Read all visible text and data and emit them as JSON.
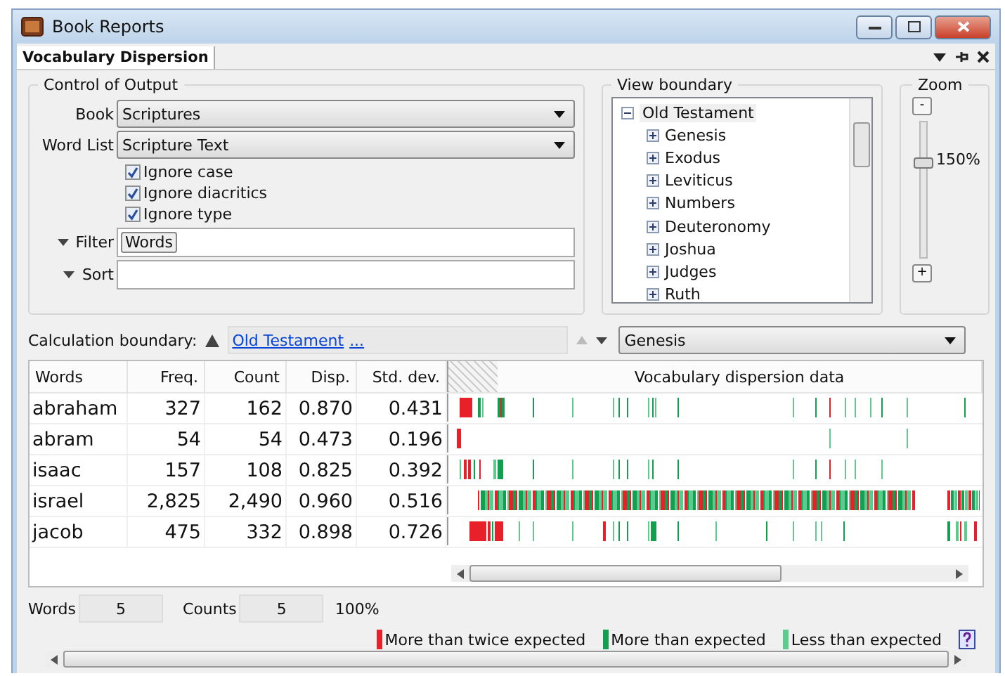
{
  "window": {
    "title": "Book Reports"
  },
  "tab": {
    "label": "Vocabulary Dispersion",
    "selected": true
  },
  "control_of_output": {
    "title": "Control of Output",
    "book": {
      "label": "Book",
      "value": "Scriptures"
    },
    "word_list": {
      "label": "Word List",
      "value": "Scripture Text"
    },
    "options": [
      {
        "label": "Ignore case",
        "checked": true
      },
      {
        "label": "Ignore diacritics",
        "checked": true
      },
      {
        "label": "Ignore type",
        "checked": true
      }
    ],
    "filter": {
      "label": "Filter",
      "token": "Words"
    },
    "sort": {
      "label": "Sort"
    }
  },
  "view_boundary": {
    "title": "View boundary",
    "tree": [
      {
        "label": "Old Testament",
        "expanded": true,
        "selected": true,
        "children": [
          {
            "label": "Genesis",
            "expanded": false,
            "selected": false
          },
          {
            "label": "Exodus",
            "expanded": false,
            "selected": false
          },
          {
            "label": "Leviticus",
            "expanded": false,
            "selected": false
          },
          {
            "label": "Numbers",
            "expanded": false,
            "selected": false
          },
          {
            "label": "Deuteronomy",
            "expanded": false,
            "selected": false
          },
          {
            "label": "Joshua",
            "expanded": false,
            "selected": false
          },
          {
            "label": "Judges",
            "expanded": false,
            "selected": false
          },
          {
            "label": "Ruth",
            "expanded": false,
            "selected": false
          }
        ]
      }
    ]
  },
  "zoom": {
    "title": "Zoom",
    "minus": "-",
    "plus": "+",
    "level": 0.72,
    "reading": "150%"
  },
  "calculation_boundary": {
    "label": "Calculation boundary:",
    "link": "Old Testament",
    "more": "..."
  },
  "view_book": {
    "value": "Genesis"
  },
  "table": {
    "columns": [
      "Words",
      "Freq.",
      "Count",
      "Disp.",
      "Std. dev.",
      "Vocabulary dispersion data"
    ],
    "rows": [
      {
        "word": "abraham",
        "freq": "327",
        "count": "162",
        "disp": "0.870",
        "std_dev": "0.431"
      },
      {
        "word": "abram",
        "freq": "54",
        "count": "54",
        "disp": "0.473",
        "std_dev": "0.196"
      },
      {
        "word": "isaac",
        "freq": "157",
        "count": "108",
        "disp": "0.825",
        "std_dev": "0.392"
      },
      {
        "word": "israel",
        "freq": "2,825",
        "count": "2,490",
        "disp": "0.960",
        "std_dev": "0.516"
      },
      {
        "word": "jacob",
        "freq": "475",
        "count": "332",
        "disp": "0.898",
        "std_dev": "0.726"
      }
    ]
  },
  "totals": {
    "words_label": "Words",
    "words": "5",
    "counts_label": "Counts",
    "counts": "5",
    "percent": "100%"
  },
  "legend": [
    {
      "label": "More than twice expected",
      "color": "#e8202a"
    },
    {
      "label": "More than expected",
      "color": "#12a050"
    },
    {
      "label": "Less than expected",
      "color": "#5ccb8e"
    }
  ]
}
